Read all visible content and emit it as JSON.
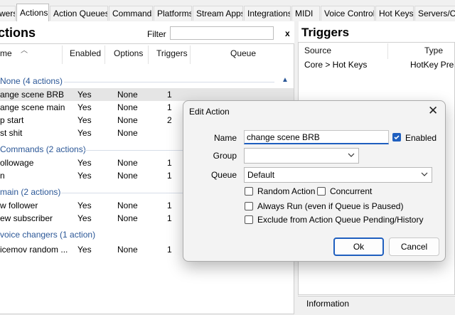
{
  "tabs": [
    {
      "label": "wers"
    },
    {
      "label": "Actions"
    },
    {
      "label": "Action Queues"
    },
    {
      "label": "Commands"
    },
    {
      "label": "Platforms"
    },
    {
      "label": "Stream Apps"
    },
    {
      "label": "Integrations"
    },
    {
      "label": "MIDI"
    },
    {
      "label": "Voice Control"
    },
    {
      "label": "Hot Keys"
    },
    {
      "label": "Servers/Cli"
    }
  ],
  "actions_panel": {
    "title": "ctions",
    "filter_label": "Filter",
    "filter_value": "",
    "clear_label": "x",
    "columns": [
      "me",
      "Enabled",
      "Options",
      "Triggers",
      "Queue"
    ],
    "groups": [
      {
        "name": "None (4 actions)",
        "rows": [
          {
            "name": "ange scene BRB",
            "enabled": "Yes",
            "options": "None",
            "triggers": "1",
            "queue": ""
          },
          {
            "name": "ange scene main",
            "enabled": "Yes",
            "options": "None",
            "triggers": "1",
            "queue": ""
          },
          {
            "name": "p start",
            "enabled": "Yes",
            "options": "None",
            "triggers": "2",
            "queue": ""
          },
          {
            "name": "st shit",
            "enabled": "Yes",
            "options": "None",
            "triggers": "",
            "queue": ""
          }
        ]
      },
      {
        "name": "Commands (2 actions)",
        "rows": [
          {
            "name": "ollowage",
            "enabled": "Yes",
            "options": "None",
            "triggers": "1",
            "queue": ""
          },
          {
            "name": "n",
            "enabled": "Yes",
            "options": "None",
            "triggers": "1",
            "queue": ""
          }
        ]
      },
      {
        "name": "main (2 actions)",
        "rows": [
          {
            "name": "w follower",
            "enabled": "Yes",
            "options": "None",
            "triggers": "1",
            "queue": ""
          },
          {
            "name": "ew subscriber",
            "enabled": "Yes",
            "options": "None",
            "triggers": "1",
            "queue": ""
          }
        ]
      },
      {
        "name": "voice changers (1 action)",
        "rows": [
          {
            "name": "icemov random ...",
            "enabled": "Yes",
            "options": "None",
            "triggers": "1",
            "queue": ""
          }
        ]
      }
    ]
  },
  "triggers_panel": {
    "title": "Triggers",
    "columns": [
      "Source",
      "Type"
    ],
    "rows": [
      {
        "source": "Core > Hot Keys",
        "type": "HotKey Press"
      }
    ],
    "info_label": "Information"
  },
  "dialog": {
    "title": "Edit Action",
    "close_glyph": "✕",
    "name_label": "Name",
    "name_value": "change scene BRB",
    "enabled_label": "Enabled",
    "enabled_checked": true,
    "group_label": "Group",
    "group_value": "",
    "queue_label": "Queue",
    "queue_value": "Default",
    "random_action_label": "Random Action",
    "random_action_checked": false,
    "concurrent_label": "Concurrent",
    "concurrent_checked": false,
    "always_run_label": "Always Run (even if Queue is Paused)",
    "always_run_checked": false,
    "exclude_label": "Exclude from Action Queue Pending/History",
    "exclude_checked": false,
    "ok_label": "Ok",
    "cancel_label": "Cancel"
  },
  "colors": {
    "accent": "#1f5fbf",
    "group_text": "#2b5797"
  }
}
